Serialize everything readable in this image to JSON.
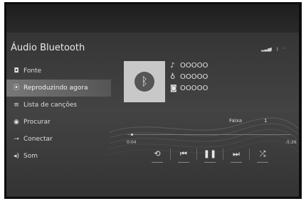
{
  "screen": {
    "title": "Áudio Bluetooth",
    "status_icons": [
      "signal-icon",
      "battery-icon",
      "bluetooth-icon",
      "wifi-icon"
    ]
  },
  "menu": {
    "items": [
      {
        "label": "Fonte",
        "icon": "source-icon",
        "active": false
      },
      {
        "label": "Reproduzindo agora",
        "icon": "now-playing-icon",
        "active": true
      },
      {
        "label": "Lista de canções",
        "icon": "playlist-icon",
        "active": false
      },
      {
        "label": "Procurar",
        "icon": "browse-icon",
        "active": false
      },
      {
        "label": "Conectar",
        "icon": "connect-icon",
        "active": false
      },
      {
        "label": "Som",
        "icon": "sound-icon",
        "active": false
      }
    ]
  },
  "track": {
    "title": "OOOOO",
    "artist": "OOOOO",
    "album": "OOOOO",
    "faixa_label": "Faixa",
    "faixa_number": "1",
    "elapsed": "0:04",
    "remaining": "-5:26",
    "progress": 0.02
  },
  "controls": {
    "buttons": [
      "repeat-icon",
      "previous-icon",
      "pause-icon",
      "next-icon",
      "shuffle-icon"
    ]
  },
  "colors": {
    "screen_bg": "#3f3f3f",
    "active_item": "#969696"
  }
}
